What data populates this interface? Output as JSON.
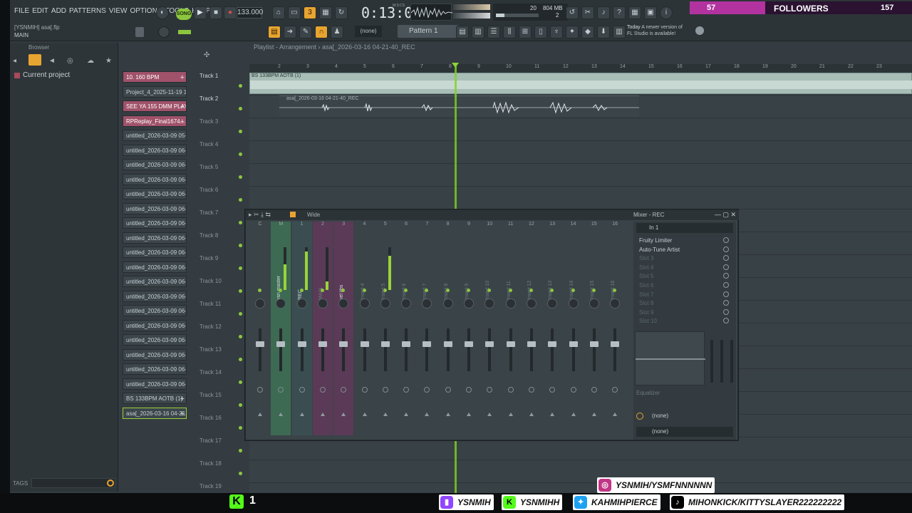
{
  "menu": [
    "FILE",
    "EDIT",
    "ADD",
    "PATTERNS",
    "VIEW",
    "OPTIONS",
    "TOOLS",
    "HELP"
  ],
  "transport": {
    "song_mode": "SONG",
    "tempo": "133.000",
    "time": "0:13:03",
    "time_unit": "M:S:CS"
  },
  "cpu": {
    "value": "20",
    "memory": "804 MB",
    "voices": "2"
  },
  "project": {
    "title": "[YSNMIH] asa[.flp",
    "main": "MAIN"
  },
  "pattern": {
    "snap": "(none)",
    "name": "Pattern 1"
  },
  "news": {
    "line1": "Today",
    "line2": "A newer version of",
    "line3": "FL Studio is available!"
  },
  "overlay": {
    "followers_count_left": "57",
    "followers_label": "FOLLOWERS",
    "followers_count_right": "157"
  },
  "browser": {
    "title": "Browser",
    "current": "Current project",
    "tags": "TAGS"
  },
  "channels": [
    {
      "name": "10. 160 BPM",
      "style": "pink"
    },
    {
      "name": "Project_4_2025-11-19 1...",
      "style": "dk"
    },
    {
      "name": "SEE YA 155 DMM PLAY...",
      "style": "pink"
    },
    {
      "name": "RPReplay_Final1674...",
      "style": "pink"
    },
    {
      "name": "untitled_2026-03-09 05-...",
      "style": "dk"
    },
    {
      "name": "untitled_2026-03-09 06-...",
      "style": "dk"
    },
    {
      "name": "untitled_2026-03-09 06-...",
      "style": "dk"
    },
    {
      "name": "untitled_2026-03-09 06-...",
      "style": "dk"
    },
    {
      "name": "untitled_2026-03-09 06-...",
      "style": "dk"
    },
    {
      "name": "untitled_2026-03-09 06-...",
      "style": "dk"
    },
    {
      "name": "untitled_2026-03-09 06-...",
      "style": "dk"
    },
    {
      "name": "untitled_2026-03-09 06-...",
      "style": "dk"
    },
    {
      "name": "untitled_2026-03-09 06-...",
      "style": "dk"
    },
    {
      "name": "untitled_2026-03-09 06-...",
      "style": "dk"
    },
    {
      "name": "untitled_2026-03-09 06-...",
      "style": "dk"
    },
    {
      "name": "untitled_2026-03-09 06-...",
      "style": "dk"
    },
    {
      "name": "untitled_2026-03-09 06-...",
      "style": "dk"
    },
    {
      "name": "untitled_2026-03-09 06-...",
      "style": "dk"
    },
    {
      "name": "untitled_2026-03-09 06-...",
      "style": "dk"
    },
    {
      "name": "untitled_2026-03-09 06-...",
      "style": "dk"
    },
    {
      "name": "untitled_2026-03-09 06-...",
      "style": "dk"
    },
    {
      "name": "untitled_2026-03-09 06-...",
      "style": "dk"
    },
    {
      "name": "BS 133BPM AOTB (1)",
      "style": "dk"
    },
    {
      "name": "asa[_2026-03-16 04-21...",
      "style": "sel"
    }
  ],
  "playlist": {
    "title": "Playlist - Arrangement › asa[_2026-03-16 04-21-40_REC",
    "ruler": [
      "2",
      "3",
      "4",
      "5",
      "6",
      "7",
      "8",
      "9",
      "10",
      "11",
      "12",
      "13",
      "14",
      "15",
      "16",
      "17",
      "18",
      "19",
      "20",
      "21",
      "22",
      "23"
    ],
    "tracks": [
      "Track 1",
      "Track 2",
      "Track 3",
      "Track 4",
      "Track 5",
      "Track 6",
      "Track 7",
      "Track 8",
      "Track 9",
      "Track 10",
      "Track 11",
      "Track 12",
      "Track 13",
      "Track 14",
      "Track 15",
      "Track 16",
      "Track 17",
      "Track 18",
      "Track 19"
    ],
    "clip1": "BS 133BPM AOTB (1)",
    "clip2": "asa[_2026-03-16 04-21-40_REC"
  },
  "mixer": {
    "title": "Mixer - REC",
    "mode": "Wide",
    "input": "In 1",
    "strips": [
      {
        "num": "C",
        "name": "",
        "on": false
      },
      {
        "num": "M",
        "name": "ysn master",
        "on": true,
        "meter": 0.6
      },
      {
        "num": "1",
        "name": "REC",
        "on": true,
        "meter": 0.9
      },
      {
        "num": "2",
        "name": "MAIN",
        "on": false,
        "meter": 0.2
      },
      {
        "num": "3",
        "name": "vel libs",
        "on": true
      },
      {
        "num": "4",
        "name": "Insert 4",
        "on": false
      },
      {
        "num": "5",
        "name": "Insert 5",
        "on": false,
        "meter": 0.8
      },
      {
        "num": "6",
        "name": "Insert 6",
        "on": false
      },
      {
        "num": "7",
        "name": "Insert 7",
        "on": false
      },
      {
        "num": "8",
        "name": "Insert 8",
        "on": false
      },
      {
        "num": "9",
        "name": "Insert 9",
        "on": false
      },
      {
        "num": "10",
        "name": "Insert 10",
        "on": false
      },
      {
        "num": "11",
        "name": "Insert 11",
        "on": false
      },
      {
        "num": "12",
        "name": "Insert 12",
        "on": false
      },
      {
        "num": "13",
        "name": "Insert 13",
        "on": false
      },
      {
        "num": "14",
        "name": "Insert 14",
        "on": false
      },
      {
        "num": "15",
        "name": "Insert 15",
        "on": false
      },
      {
        "num": "16",
        "name": "Insert 16",
        "on": false
      }
    ],
    "slots": [
      {
        "name": "Fruity Limiter",
        "used": true
      },
      {
        "name": "Auto-Tune Artist",
        "used": true
      },
      {
        "name": "Slot 3",
        "used": false
      },
      {
        "name": "Slot 4",
        "used": false
      },
      {
        "name": "Slot 5",
        "used": false
      },
      {
        "name": "Slot 6",
        "used": false
      },
      {
        "name": "Slot 7",
        "used": false
      },
      {
        "name": "Slot 8",
        "used": false
      },
      {
        "name": "Slot 9",
        "used": false
      },
      {
        "name": "Slot 10",
        "used": false
      }
    ],
    "eq_label": "Equalizer",
    "out1": "(none)",
    "out2": "(none)"
  },
  "social": {
    "kick_count": "1",
    "instagram": "YSNMIH/YSMFNNNNNN",
    "twitch": "YSNMIH",
    "kick": "YSNMIHH",
    "twitter": "KAHMIHPIERCE",
    "tiktok": "MIHONKICK/KITTYSLAYER222222222"
  }
}
